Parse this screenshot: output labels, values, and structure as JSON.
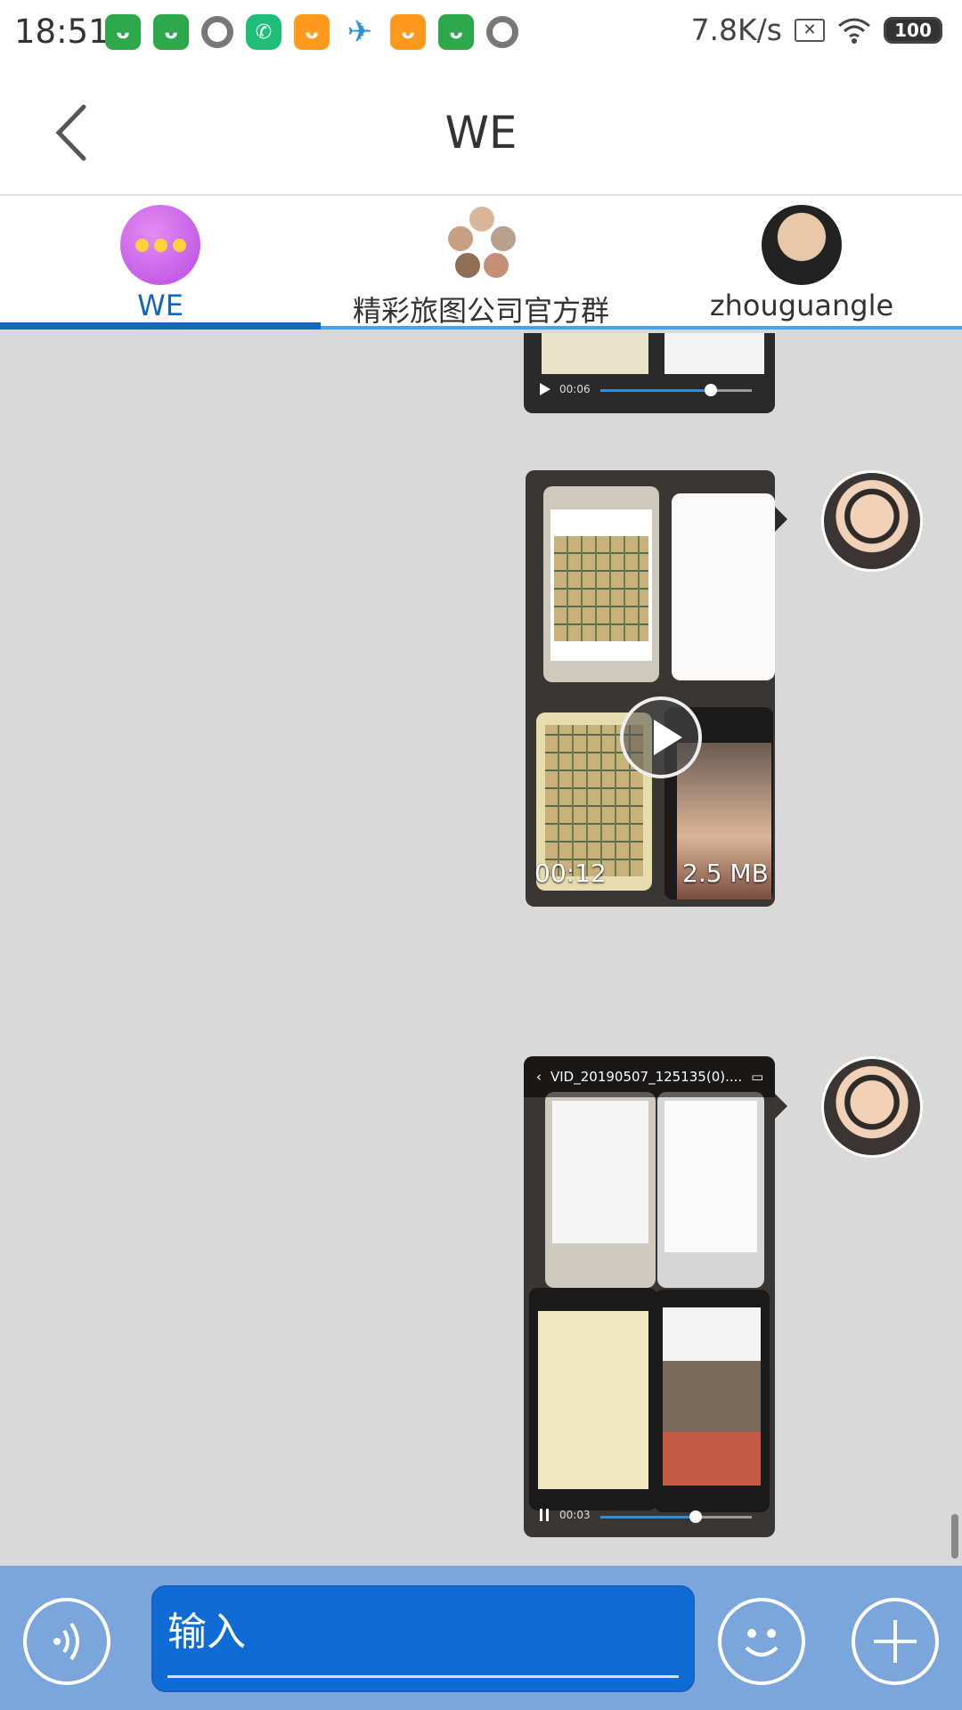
{
  "status_bar": {
    "time": "18:51",
    "network_speed": "7.8K/s",
    "battery": "100",
    "notification_icons": [
      "shopping-bag-icon",
      "shopping-bag-icon",
      "circle-icon",
      "chat-app-icon",
      "orange-app-icon",
      "paper-plane-icon",
      "orange-app-icon",
      "shopping-bag-icon",
      "circle-icon"
    ]
  },
  "header": {
    "title": "WE",
    "back_icon": "chevron-left-icon"
  },
  "tabs": [
    {
      "label": "WE",
      "active": true
    },
    {
      "label": "精彩旅图公司官方群",
      "active": false
    },
    {
      "label": "zhouguangle",
      "active": false
    }
  ],
  "messages": [
    {
      "type": "video_player",
      "current_time": "00:06",
      "progress": 0.72
    },
    {
      "type": "video",
      "duration": "00:12",
      "size": "2.5 MB"
    },
    {
      "type": "video_player",
      "title": "VID_20190507_125135(0)....",
      "current_time": "00:03",
      "progress": 0.62
    }
  ],
  "input_bar": {
    "placeholder": "输入"
  },
  "colors": {
    "accent": "#1565c0",
    "input_bar_bg": "#7aa6dc",
    "input_field_bg": "#0e6cd4",
    "chat_bg": "#d9d9d9"
  }
}
